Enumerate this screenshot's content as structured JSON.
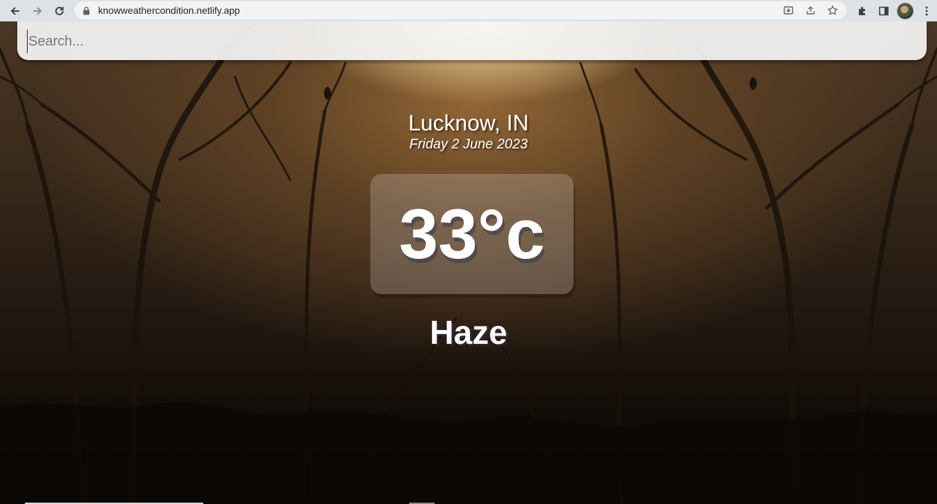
{
  "browser": {
    "url": "knowweathercondition.netlify.app",
    "icons": [
      "back-icon",
      "forward-icon",
      "reload-icon",
      "lock-icon",
      "install-icon",
      "share-icon",
      "bookmark-star-icon",
      "extensions-icon",
      "side-panel-icon",
      "profile-avatar",
      "menu-icon"
    ]
  },
  "search": {
    "placeholder": "Search...",
    "value": ""
  },
  "weather": {
    "location": "Lucknow, IN",
    "date": "Friday 2 June 2023",
    "temperature": "33°c",
    "condition": "Haze"
  },
  "colors": {
    "text": "#ffffff",
    "search_bg": "#f5f5f5",
    "chrome_bg": "#dee1e6"
  }
}
